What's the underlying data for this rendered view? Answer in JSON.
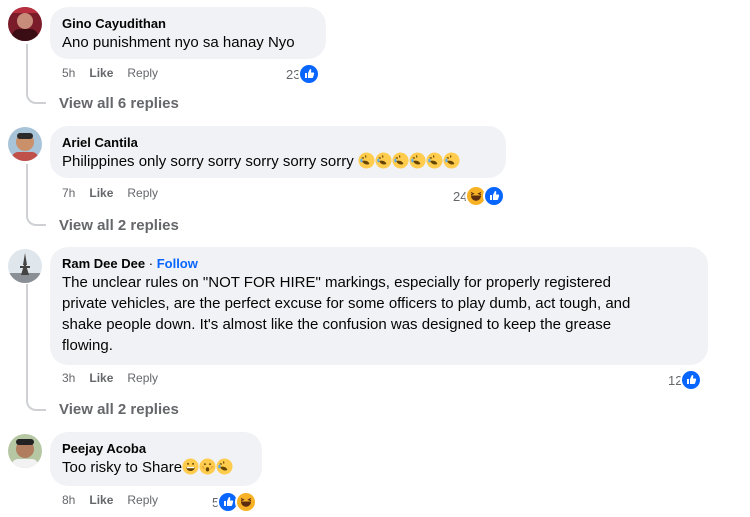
{
  "comments": [
    {
      "name": "Gino Cayudithan",
      "text": "Ano punishment nyo sa hanay Nyo",
      "time": "5h",
      "like": "Like",
      "reply": "Reply",
      "reaction_count": "23",
      "reactions": [
        "like"
      ],
      "view_replies": "View all 6 replies"
    },
    {
      "name": "Ariel Cantila",
      "text": "Philippines only sorry sorry sorry sorry sorry",
      "emojis": [
        "rofl-emoji",
        "rofl-emoji",
        "rofl-emoji",
        "rofl-emoji",
        "rofl-emoji",
        "rofl-emoji"
      ],
      "time": "7h",
      "like": "Like",
      "reply": "Reply",
      "reaction_count": "24",
      "reactions": [
        "haha",
        "like"
      ],
      "view_replies": "View all 2 replies"
    },
    {
      "name": "Ram Dee Dee",
      "separator": "·",
      "follow": "Follow",
      "text_lines": [
        "The unclear rules on \"NOT FOR HIRE\" markings, especially for properly registered",
        "private vehicles, are the perfect excuse for some officers to play dumb, act tough, and",
        "shake people down. It's almost like the confusion was designed to keep the grease",
        "flowing."
      ],
      "time": "3h",
      "like": "Like",
      "reply": "Reply",
      "reaction_count": "12",
      "reactions": [
        "like"
      ],
      "view_replies": "View all 2 replies"
    },
    {
      "name": "Peejay Acoba",
      "text": "Too risky to Share",
      "emojis": [
        "grin-emoji",
        "surprised-emoji",
        "rofl-emoji"
      ],
      "time": "8h",
      "like": "Like",
      "reply": "Reply",
      "reaction_count": "5",
      "reactions": [
        "like",
        "haha"
      ]
    }
  ],
  "colors": {
    "bubble": "#f0f2f5",
    "like_blue": "#0866ff",
    "meta_gray": "#65676b",
    "haha_yellow": "#f7b125"
  }
}
